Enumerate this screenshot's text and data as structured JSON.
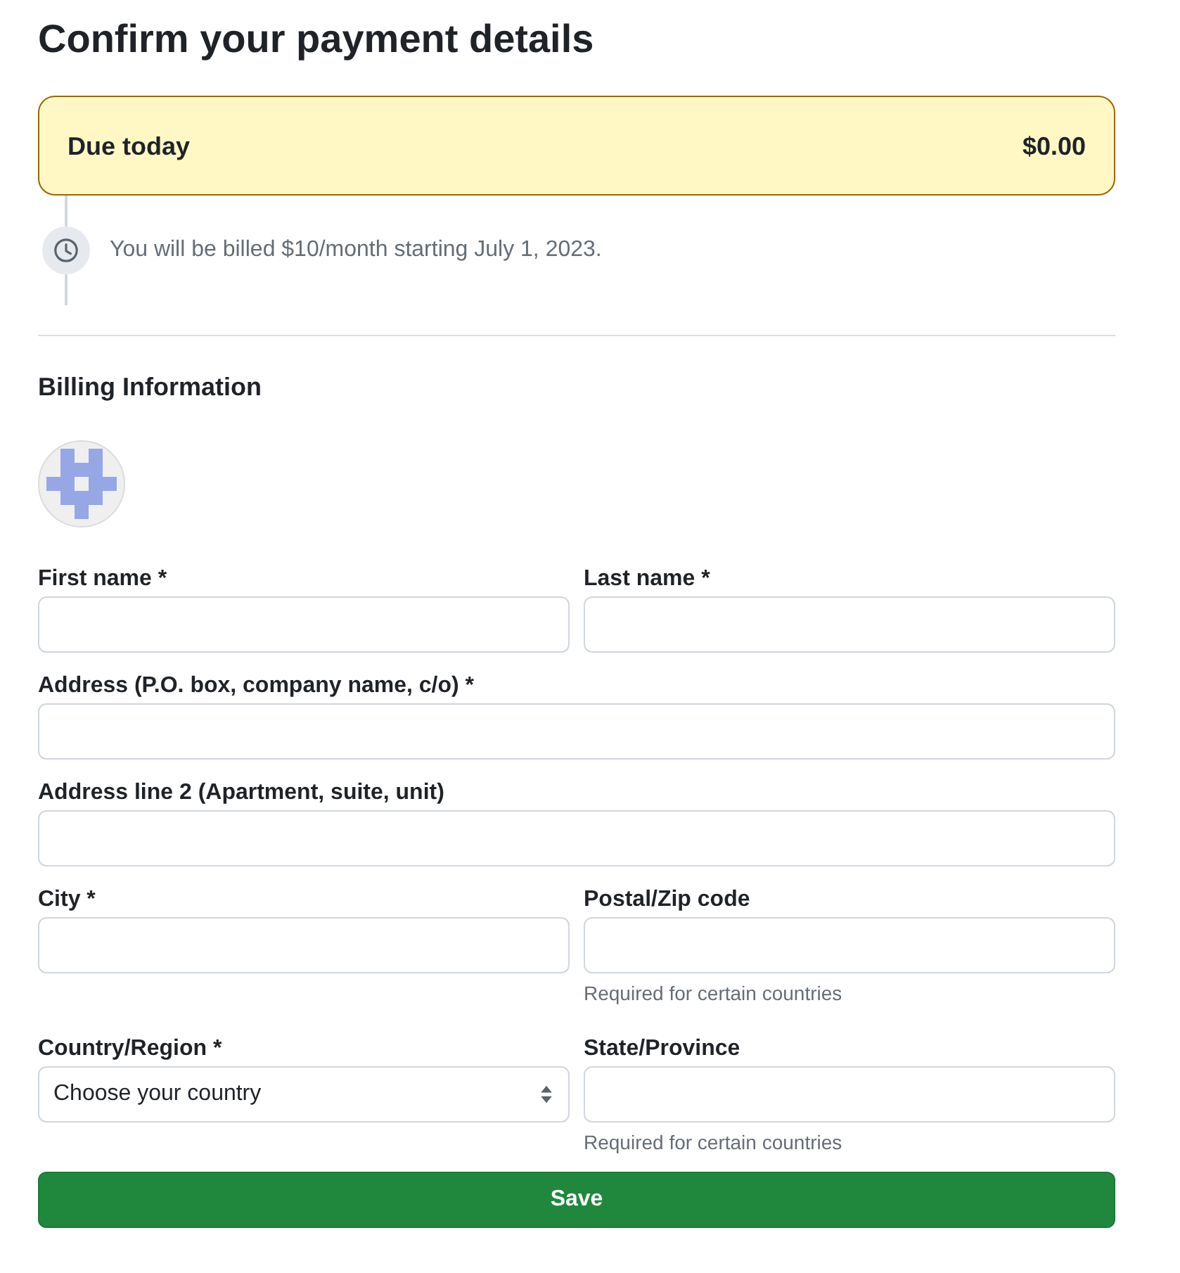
{
  "title": "Confirm your payment details",
  "due_today": {
    "label": "Due today",
    "amount": "$0.00"
  },
  "billing_note": "You will be billed $10/month starting July 1, 2023.",
  "billing_information": {
    "heading": "Billing Information",
    "rows": [
      {
        "fields": [
          {
            "kind": "text",
            "label": "First name *"
          },
          {
            "kind": "text",
            "label": "Last name *"
          }
        ]
      },
      {
        "fields": [
          {
            "kind": "text",
            "label": "Address (P.O. box, company name, c/o) *"
          }
        ]
      },
      {
        "fields": [
          {
            "kind": "text",
            "label": "Address line 2 (Apartment, suite, unit)"
          }
        ]
      },
      {
        "fields": [
          {
            "kind": "text",
            "label": "City *"
          },
          {
            "kind": "text",
            "label": "Postal/Zip code",
            "hint": "Required for certain countries"
          }
        ]
      },
      {
        "fields": [
          {
            "kind": "select",
            "label": "Country/Region *",
            "value": "Choose your country"
          },
          {
            "kind": "text",
            "label": "State/Province",
            "hint": "Required for certain countries"
          }
        ]
      }
    ],
    "save_button": "Save"
  }
}
